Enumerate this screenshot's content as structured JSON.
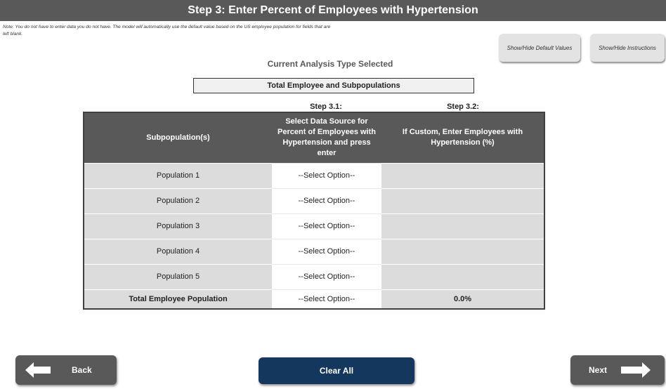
{
  "title": "Step 3: Enter Percent of Employees with Hypertension",
  "note": "Note: You do not have to enter data you do not have. The model will automatically use the default value based on the US employee population for fields that are left blank.",
  "buttons": {
    "show_hide_default": "Show/Hide Default Values",
    "show_hide_instructions": "Show/Hide Instructions",
    "back": "Back",
    "clear_all": "Clear All",
    "next": "Next"
  },
  "analysis": {
    "heading": "Current Analysis Type Selected",
    "value": "Total Employee and Subpopulations"
  },
  "steps": {
    "step_3_1": "Step 3.1:",
    "step_3_2": "Step 3.2:"
  },
  "table": {
    "headers": [
      "Subpopulation(s)",
      "Select Data Source for Percent of Employees with Hypertension and press enter",
      "If Custom, Enter Employees with Hypertension (%)"
    ],
    "rows": [
      {
        "population": "Population 1",
        "source": "--Select Option--",
        "value": ""
      },
      {
        "population": "Population 2",
        "source": "--Select Option--",
        "value": ""
      },
      {
        "population": "Population 3",
        "source": "--Select Option--",
        "value": ""
      },
      {
        "population": "Population 4",
        "source": "--Select Option--",
        "value": ""
      },
      {
        "population": "Population 5",
        "source": "--Select Option--",
        "value": ""
      }
    ],
    "total": {
      "population": "Total Employee Population",
      "source": "--Select Option--",
      "value": "0.0%"
    }
  },
  "colors": {
    "header_bg": "#595959",
    "clear_button": "#14375e",
    "cell_gray": "#dcdcdc"
  }
}
